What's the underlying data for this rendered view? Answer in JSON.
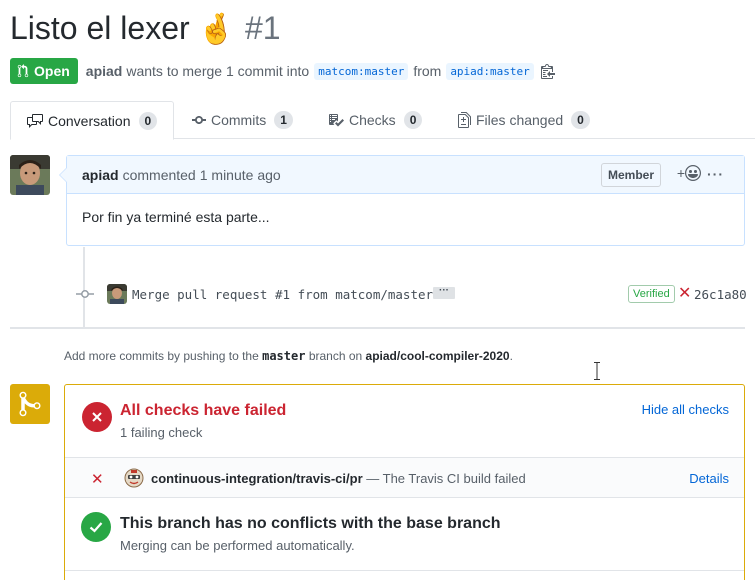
{
  "pr": {
    "title": "Listo el lexer",
    "title_emoji": "🤞",
    "number": "#1",
    "state": "Open",
    "author": "apiad",
    "merge_text": "wants to merge 1 commit into",
    "base_branch": "matcom:master",
    "from_text": "from",
    "head_branch": "apiad:master"
  },
  "tabs": [
    {
      "label": "Conversation",
      "count": "0",
      "icon": "comment-discussion-icon"
    },
    {
      "label": "Commits",
      "count": "1",
      "icon": "git-commit-icon"
    },
    {
      "label": "Checks",
      "count": "0",
      "icon": "checklist-icon"
    },
    {
      "label": "Files changed",
      "count": "0",
      "icon": "file-diff-icon"
    }
  ],
  "comment": {
    "author": "apiad",
    "action": "commented",
    "time": "1 minute ago",
    "badge": "Member",
    "reaction_plus": "+",
    "more": "···",
    "body": "Por fin ya terminé esta parte..."
  },
  "commit": {
    "message": "Merge pull request #1 from matcom/master",
    "ellipsis": "···",
    "verified": "Verified",
    "sha": "26c1a80"
  },
  "push_hint": {
    "prefix": "Add more commits by pushing to the",
    "branch": "master",
    "middle": "branch on",
    "repo": "apiad/cool-compiler-2020",
    "suffix": "."
  },
  "merge": {
    "checks_title": "All checks have failed",
    "checks_sub": "1 failing check",
    "hide_label": "Hide all checks",
    "check_name": "continuous-integration/travis-ci/pr",
    "check_desc": "— The Travis CI build failed",
    "details_label": "Details",
    "conflict_title": "This branch has no conflicts with the base branch",
    "conflict_sub": "Merging can be performed automatically."
  },
  "colors": {
    "open_green": "#28a745",
    "link_blue": "#0366d6",
    "fail_red": "#cb2431",
    "merge_yellow": "#dbab09"
  }
}
